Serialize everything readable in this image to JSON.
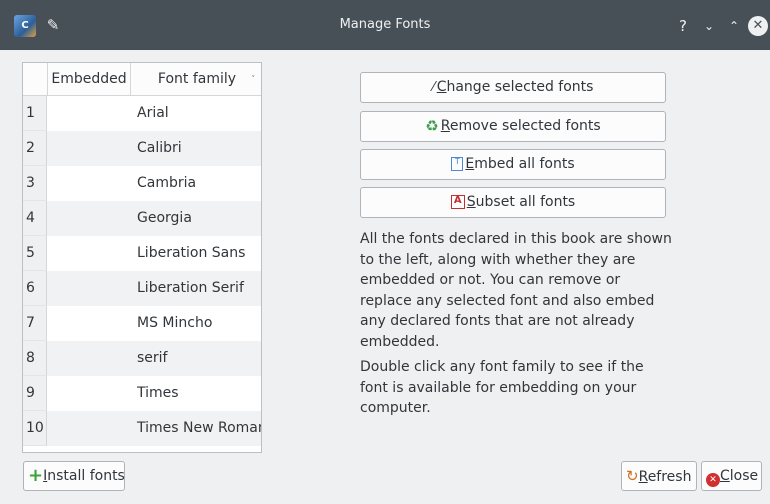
{
  "window": {
    "title": "Manage Fonts",
    "app_icon": "calibre-icon",
    "pin_icon": "pin-icon",
    "controls": {
      "help": "?",
      "minimize": "⌄",
      "maximize": "⌃",
      "close": "✕"
    }
  },
  "table": {
    "headers": {
      "embedded": "Embedded",
      "family": "Font family",
      "sort_indicator": "˅"
    },
    "rows": [
      {
        "num": "1",
        "embedded": "",
        "family": "Arial"
      },
      {
        "num": "2",
        "embedded": "",
        "family": "Calibri"
      },
      {
        "num": "3",
        "embedded": "",
        "family": "Cambria"
      },
      {
        "num": "4",
        "embedded": "",
        "family": "Georgia"
      },
      {
        "num": "5",
        "embedded": "",
        "family": "Liberation Sans"
      },
      {
        "num": "6",
        "embedded": "",
        "family": "Liberation Serif"
      },
      {
        "num": "7",
        "embedded": "",
        "family": "MS Mincho"
      },
      {
        "num": "8",
        "embedded": "",
        "family": "serif"
      },
      {
        "num": "9",
        "embedded": "",
        "family": "Times"
      },
      {
        "num": "10",
        "embedded": "",
        "family": "Times New Roman"
      }
    ]
  },
  "actions": {
    "change": {
      "mnemonic": "C",
      "rest": "hange selected fonts",
      "icon": "magic-wand-icon"
    },
    "remove": {
      "mnemonic": "R",
      "rest": "emove selected fonts",
      "icon": "recycle-icon"
    },
    "embed": {
      "mnemonic": "E",
      "rest": "mbed all fonts",
      "icon": "embed-font-icon"
    },
    "subset": {
      "mnemonic": "S",
      "rest": "ubset all fonts",
      "icon": "subset-font-icon"
    }
  },
  "description": {
    "para1": "All the fonts declared in this book are shown to the left, along with whether they are embedded or not. You can remove or replace any selected font and also embed any declared fonts that are not already embedded.",
    "para2": "Double click any font family to see if the font is available for embedding on your computer."
  },
  "footer": {
    "install": {
      "mnemonic": "I",
      "rest": "nstall fonts"
    },
    "refresh": {
      "mnemonic": "R",
      "rest": "efresh"
    },
    "close": {
      "mnemonic": "C",
      "rest": "lose"
    }
  },
  "colors": {
    "titlebar": "#475057",
    "window_bg": "#eff0f1",
    "accent_green": "#3aa33a",
    "close_red": "#d03030"
  }
}
